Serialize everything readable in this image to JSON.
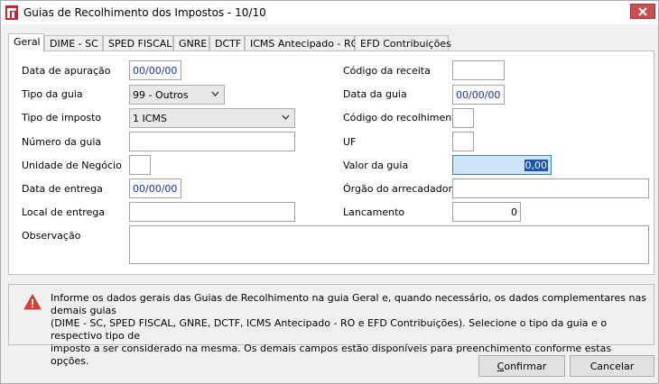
{
  "window": {
    "title": "Guias de Recolhimento dos Impostos - 10/10"
  },
  "tabs": [
    {
      "label": "Geral"
    },
    {
      "label": "DIME - SC"
    },
    {
      "label": "SPED FISCAL"
    },
    {
      "label": "GNRE"
    },
    {
      "label": "DCTF"
    },
    {
      "label": "ICMS Antecipado - RO"
    },
    {
      "label": "EFD Contribuições"
    }
  ],
  "form": {
    "data_apuracao_label": "Data de apuração",
    "data_apuracao_value": "00/00/00",
    "tipo_guia_label": "Tipo da guia",
    "tipo_guia_value": "99 - Outros",
    "tipo_imposto_label": "Tipo de imposto",
    "tipo_imposto_value": "1 ICMS",
    "numero_guia_label": "Número da guia",
    "numero_guia_value": "",
    "unidade_negocio_label": "Unidade de Negócio",
    "unidade_negocio_value": "",
    "data_entrega_label": "Data de entrega",
    "data_entrega_value": "00/00/00",
    "local_entrega_label": "Local de entrega",
    "local_entrega_value": "",
    "observacao_label": "Observação",
    "observacao_value": "",
    "codigo_receita_label": "Código da receita",
    "codigo_receita_value": "",
    "data_guia_label": "Data da guia",
    "data_guia_value": "00/00/00",
    "codigo_recolhimento_label": "Código do recolhimento",
    "codigo_recolhimento_value": "",
    "uf_label": "UF",
    "uf_value": "",
    "valor_guia_label": "Valor da guia",
    "valor_guia_value": "0,00",
    "orgao_arrecadador_label": "Órgão do arrecadador",
    "orgao_arrecadador_value": "",
    "lancamento_label": "Lancamento",
    "lancamento_value": "0"
  },
  "info": {
    "line1": "Informe os dados gerais das Guias de Recolhimento na guia Geral e, quando necessário, os dados complementares nas demais guias",
    "line2": "(DIME - SC, SPED FISCAL, GNRE, DCTF, ICMS Antecipado - RO e EFD Contribuições). Selecione o tipo da guia e o respectivo tipo de",
    "line3": "imposto a ser considerado na mesma. Os demais campos estão disponíveis para preenchimento conforme estas opções."
  },
  "buttons": {
    "confirm_accel": "C",
    "confirm_rest": "onfirmar",
    "cancel": "Cancelar"
  },
  "colors": {
    "close_button": "#c75050",
    "warning_icon": "#e03c31",
    "date_text": "#1a2fa6",
    "selection": "#1a53b4"
  }
}
